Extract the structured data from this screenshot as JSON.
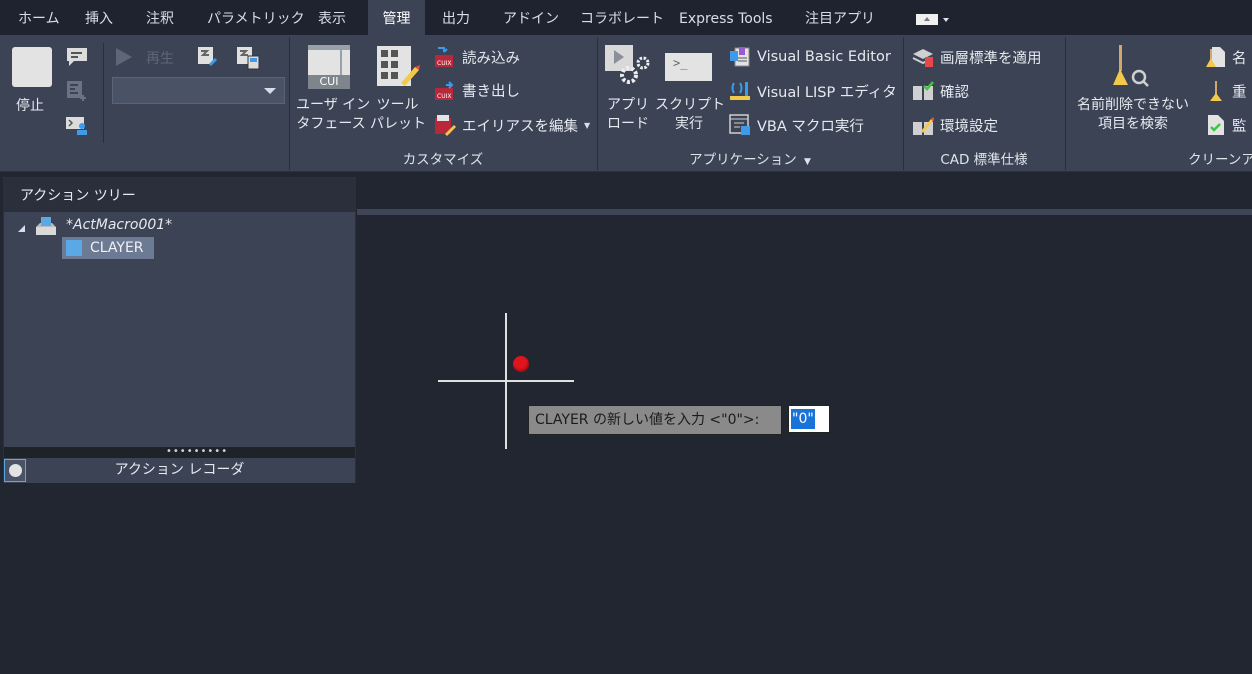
{
  "tabs": [
    {
      "label": "ホーム",
      "active": false
    },
    {
      "label": "挿入",
      "active": false
    },
    {
      "label": "注釈",
      "active": false
    },
    {
      "label": "パラメトリック",
      "active": false
    },
    {
      "label": "表示",
      "active": false
    },
    {
      "label": "管理",
      "active": true
    },
    {
      "label": "出力",
      "active": false
    },
    {
      "label": "アドイン",
      "active": false
    },
    {
      "label": "コラボレート",
      "active": false
    },
    {
      "label": "Express Tools",
      "active": false
    },
    {
      "label": "注目アプリ",
      "active": false
    }
  ],
  "ribbon": {
    "action_recorder": {
      "stop_label": "停止",
      "play_label": "再生",
      "macro_select_value": ""
    },
    "customize": {
      "title": "カスタマイズ",
      "cui_icon_text": "CUI",
      "user_interface_line1": "ユーザ イン",
      "user_interface_line2": "タフェース",
      "tool_palette_line1": "ツール",
      "tool_palette_line2": "パレット",
      "import_label": "読み込み",
      "export_label": "書き出し",
      "edit_aliases_label": "エイリアスを編集",
      "cuix_badge": "CUIX"
    },
    "applications": {
      "title": "アプリケーション",
      "load_app_line1": "アプリ",
      "load_app_line2": "ロード",
      "run_script_line1": "スクリプト",
      "run_script_line2": "実行",
      "script_icon_text": ">_",
      "vbe_label": "Visual Basic Editor",
      "vlisp_label": "Visual LISP エディタ",
      "vba_run_label": "VBA マクロ実行"
    },
    "cad_standards": {
      "title": "CAD 標準仕様",
      "layer_translate_label": "画層標準を適用",
      "check_label": "確認",
      "configure_label": "環境設定"
    },
    "cleanup": {
      "title": "クリーンア",
      "find_nonpurgeable_line1": "名前削除できない",
      "find_nonpurgeable_line2": "項目を検索",
      "item1_label": "名",
      "item2_label": "重",
      "item3_label": "監"
    }
  },
  "action_panel": {
    "header": "アクション ツリー",
    "macro_name": "*ActMacro001*",
    "child_item": "CLAYER",
    "grip_dots": "•••••••••",
    "footer": "アクション レコーダ"
  },
  "command_prompt": {
    "text": "CLAYER の新しい値を入力 <\"0\">:",
    "input_value": "\"0\""
  },
  "colors": {
    "accent_blue": "#1a73d9",
    "record_red": "#e0141c",
    "ribbon_bg": "#3b4354",
    "canvas_bg": "#222631"
  }
}
